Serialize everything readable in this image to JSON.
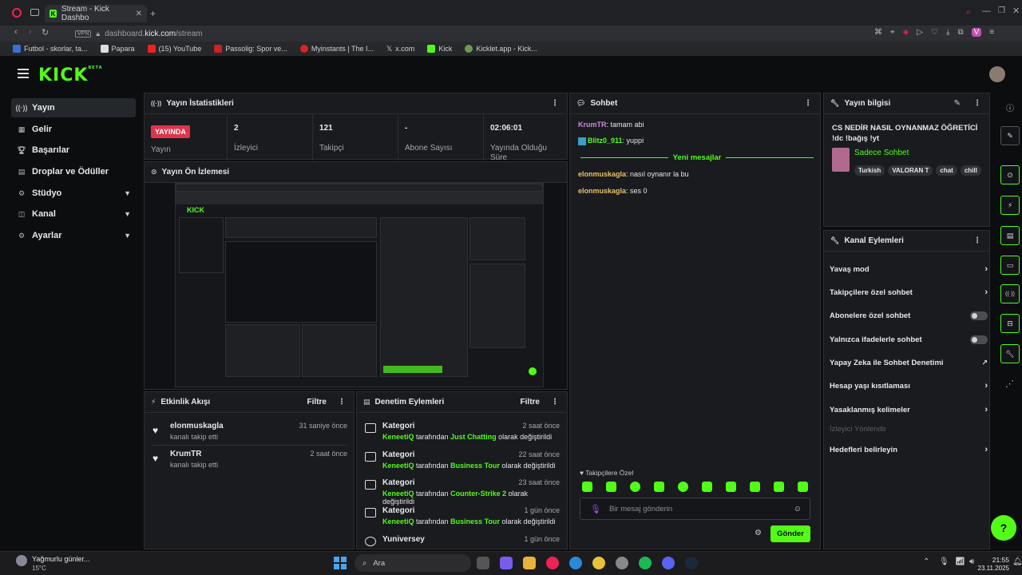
{
  "browser": {
    "tab_title": "Stream - Kick Dashbo",
    "url_prefix": "dashboard.",
    "url_host": "kick.com",
    "url_path": "/stream",
    "vpn": "VPN",
    "bookmarks": [
      "Futbol - skorlar, ta...",
      "Papara",
      "(15) YouTube",
      "Passolig: Spor ve...",
      "Myinstants | The I...",
      "x.com",
      "Kick",
      "Kicklet.app - Kick..."
    ]
  },
  "header": {
    "logo": "KICK",
    "logo_sup": "BETA"
  },
  "sidebar": {
    "items": [
      {
        "label": "Yayın"
      },
      {
        "label": "Gelir"
      },
      {
        "label": "Başarılar"
      },
      {
        "label": "Droplar ve Ödüller"
      },
      {
        "label": "Stüdyo"
      },
      {
        "label": "Kanal"
      },
      {
        "label": "Ayarlar"
      }
    ]
  },
  "stats": {
    "title": "Yayın İstatistikleri",
    "live_badge": "YAYINDA",
    "cols": [
      {
        "value": "",
        "label": "Yayın"
      },
      {
        "value": "2",
        "label": "İzleyici"
      },
      {
        "value": "121",
        "label": "Takipçi"
      },
      {
        "value": "-",
        "label": "Abone Sayısı"
      },
      {
        "value": "02:06:01",
        "label": "Yayında Olduğu Süre"
      }
    ]
  },
  "preview": {
    "title": "Yayın Ön İzlemesi"
  },
  "activity": {
    "title": "Etkinlik Akışı",
    "filter": "Filtre",
    "items": [
      {
        "name": "elonmuskagla",
        "sub": "kanalı takip etti",
        "time": "31 saniye önce"
      },
      {
        "name": "KrumTR",
        "sub": "kanalı takip etti",
        "time": "2 saat önce"
      }
    ]
  },
  "moderation": {
    "title": "Denetim Eylemleri",
    "filter": "Filtre",
    "items": [
      {
        "title": "Kategori",
        "user": "KeneetiQ",
        "mid": "tarafından",
        "target": "Just Chatting",
        "end": "olarak değiştirildi",
        "time": "2 saat önce"
      },
      {
        "title": "Kategori",
        "user": "KeneetiQ",
        "mid": "tarafından",
        "target": "Business Tour",
        "end": "olarak değiştirildi",
        "time": "22 saat önce"
      },
      {
        "title": "Kategori",
        "user": "KeneetiQ",
        "mid": "tarafından",
        "target": "Counter-Strike 2",
        "end": "olarak değiştirildi",
        "time": "23 saat önce"
      },
      {
        "title": "Kategori",
        "user": "KeneetiQ",
        "mid": "tarafından",
        "target": "Business Tour",
        "end": "olarak değiştirildi",
        "time": "1 gün önce"
      },
      {
        "title": "Yuniversey",
        "user": "",
        "mid": "",
        "target": "",
        "end": "",
        "time": "1 gün önce"
      }
    ]
  },
  "chat": {
    "title": "Sohbet",
    "messages": [
      {
        "user": "KrumTR",
        "text": "tamam abi",
        "color": "#c98bd8"
      },
      {
        "user": "Blitz0_911",
        "text": "yuppi",
        "color": "#53fc18"
      },
      {
        "user": "elonmuskagla",
        "text": "nasıl oynanır la bu",
        "color": "#e8c06a"
      },
      {
        "user": "elonmuskagla",
        "text": "ses 0",
        "color": "#e8c06a"
      }
    ],
    "new_messages": "Yeni mesajlar",
    "followers_only": "Takipçilere Özel",
    "input_placeholder": "Bir mesaj gönderin",
    "send": "Gönder"
  },
  "info": {
    "title": "Yayın bilgisi",
    "stream_title": "CS NEDİR NASIL OYNANMAZ ÖĞRETİCİ !dc !bağış !yt",
    "category": "Sadece Sohbet",
    "tags": [
      "Turkish",
      "VALORAN T",
      "chat",
      "chill"
    ]
  },
  "channel": {
    "title": "Kanal Eylemleri",
    "items": [
      {
        "label": "Yavaş mod",
        "kind": "chevron"
      },
      {
        "label": "Takipçilere özel sohbet",
        "kind": "chevron"
      },
      {
        "label": "Abonelere özel sohbet",
        "kind": "toggle"
      },
      {
        "label": "Yalnızca ifadelerle sohbet",
        "kind": "toggle"
      },
      {
        "label": "Yapay Zeka ile Sohbet Denetimi",
        "kind": "external"
      },
      {
        "label": "Hesap yaşı kısıtlaması",
        "kind": "chevron"
      },
      {
        "label": "Yasaklanmış kelimeler",
        "kind": "chevron"
      },
      {
        "label": "İzleyici Yönlendir",
        "kind": "disabled"
      },
      {
        "label": "Hedefleri belirleyin",
        "kind": "chevron"
      }
    ]
  },
  "taskbar": {
    "weather": "Yağmurlu günler...",
    "temp": "15°C",
    "search": "Ara",
    "time": "21:55",
    "date": "23.11.2025"
  },
  "colors": {
    "accent": "#53fc18",
    "live": "#e0344a",
    "panel": "#191b1f",
    "bg": "#0b0d0f"
  }
}
